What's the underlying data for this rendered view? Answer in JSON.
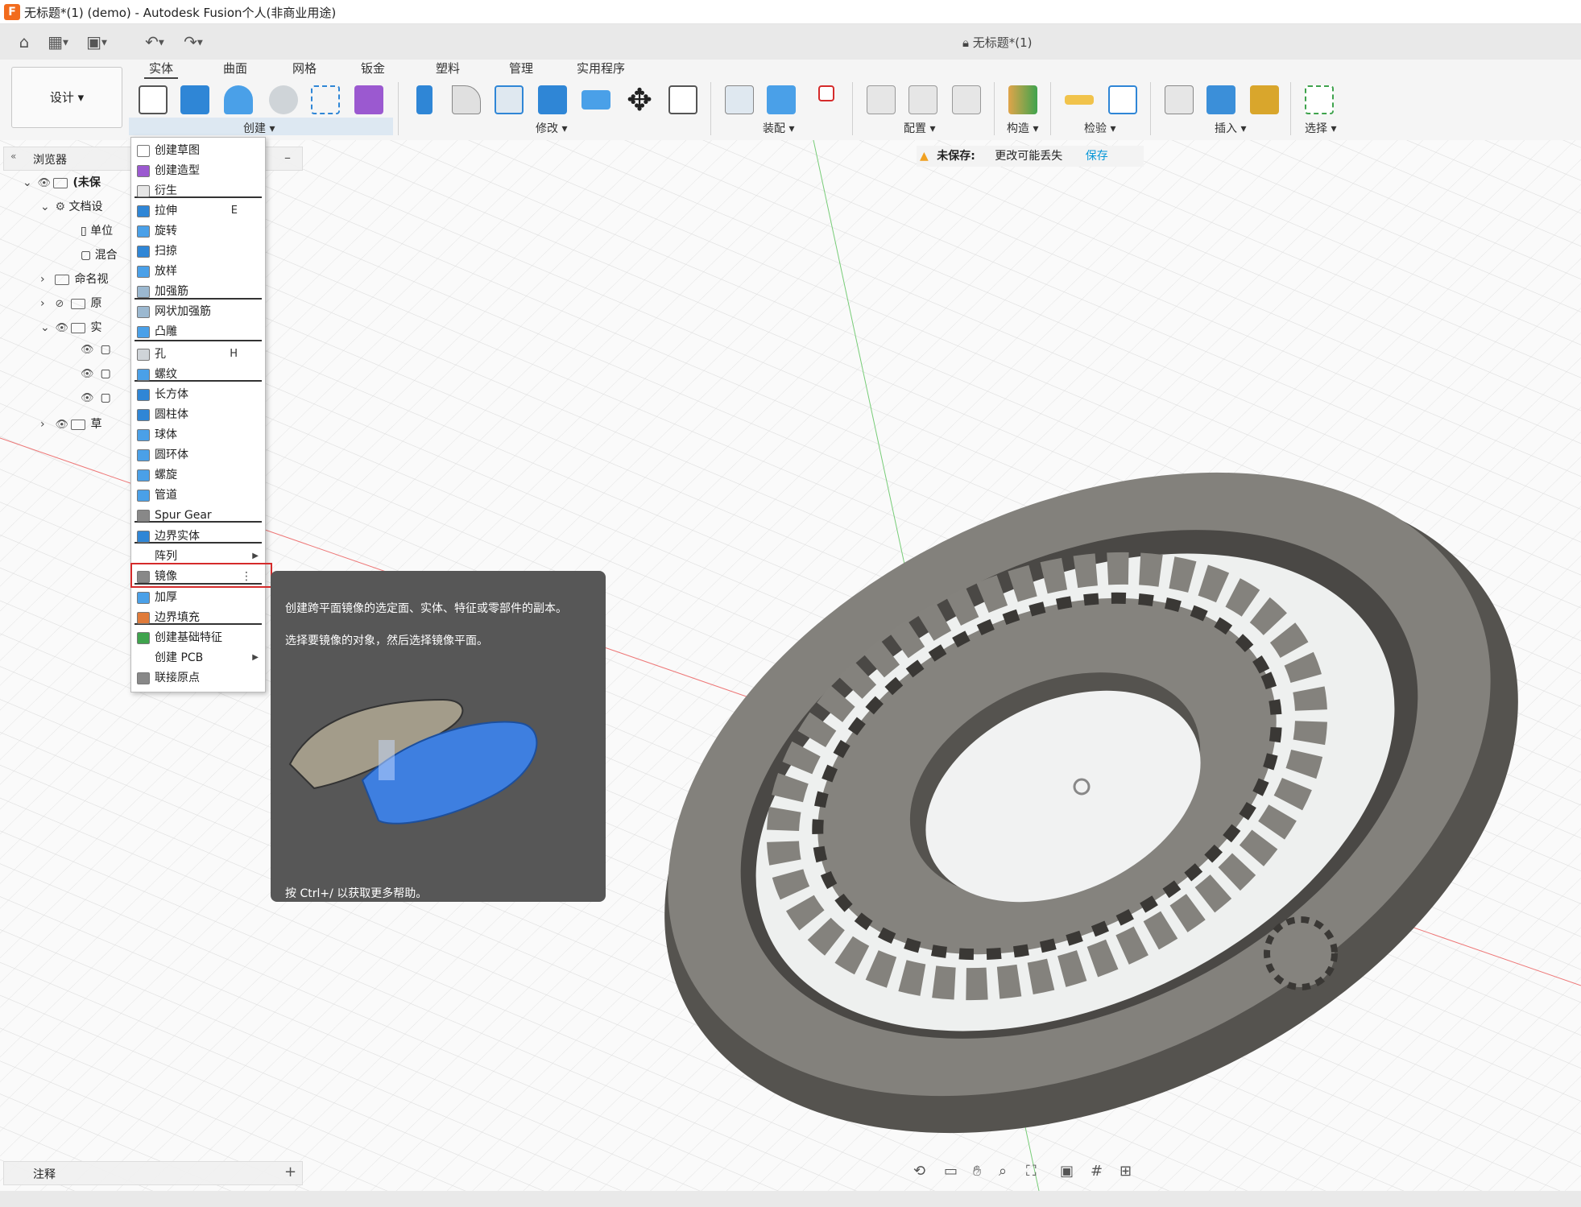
{
  "window": {
    "title": "无标题*(1) (demo) - Autodesk Fusion个人(非商业用途)",
    "document_title": "无标题*(1)"
  },
  "toolbar": {
    "workspace_button": "设计 ▾",
    "tabs": [
      "实体",
      "曲面",
      "网格",
      "钣金",
      "塑料",
      "管理",
      "实用程序"
    ],
    "groups": [
      "创建 ▾",
      "修改 ▾",
      "装配 ▾",
      "配置 ▾",
      "构造 ▾",
      "检验 ▾",
      "插入 ▾",
      "选择 ▾"
    ]
  },
  "unsaved_bar": {
    "label": "未保存:",
    "message": "更改可能丢失",
    "save": "保存"
  },
  "browser": {
    "header": "浏览器",
    "rows": [
      {
        "label": "(未保"
      },
      {
        "label": "文档设"
      },
      {
        "label": "单位"
      },
      {
        "label": "混合"
      },
      {
        "label": "命名视"
      },
      {
        "label": "原"
      },
      {
        "label": "实"
      },
      {
        "label": ""
      },
      {
        "label": ""
      },
      {
        "label": ""
      },
      {
        "label": "草"
      }
    ],
    "footer": "注释"
  },
  "create_menu": {
    "items": [
      {
        "label": "创建草图",
        "icon": "sketch-icon"
      },
      {
        "label": "创建造型",
        "icon": "form-icon"
      },
      {
        "label": "衍生",
        "icon": "derive-icon"
      },
      {
        "label": "拉伸",
        "icon": "extrude-icon",
        "shortcut": "E"
      },
      {
        "label": "旋转",
        "icon": "revolve-icon"
      },
      {
        "label": "扫掠",
        "icon": "sweep-icon"
      },
      {
        "label": "放样",
        "icon": "loft-icon"
      },
      {
        "label": "加强筋",
        "icon": "rib-icon"
      },
      {
        "label": "网状加强筋",
        "icon": "web-icon"
      },
      {
        "label": "凸雕",
        "icon": "emboss-icon"
      },
      {
        "label": "孔",
        "icon": "hole-icon",
        "shortcut": "H"
      },
      {
        "label": "螺纹",
        "icon": "thread-icon"
      },
      {
        "label": "长方体",
        "icon": "box-icon"
      },
      {
        "label": "圆柱体",
        "icon": "cylinder-icon"
      },
      {
        "label": "球体",
        "icon": "sphere-icon"
      },
      {
        "label": "圆环体",
        "icon": "torus-icon"
      },
      {
        "label": "螺旋",
        "icon": "coil-icon"
      },
      {
        "label": "管道",
        "icon": "pipe-icon"
      },
      {
        "label": "Spur Gear",
        "icon": "gear-icon"
      },
      {
        "label": "边界实体",
        "icon": "boundary-icon"
      },
      {
        "label": "阵列",
        "icon": "",
        "submenu": "▶"
      },
      {
        "label": "镜像",
        "icon": "mirror-icon",
        "more": "⋮"
      },
      {
        "label": "加厚",
        "icon": "thicken-icon"
      },
      {
        "label": "边界填充",
        "icon": "boundary-fill-icon"
      },
      {
        "label": "创建基础特征",
        "icon": "base-feature-icon"
      },
      {
        "label": "创建 PCB",
        "icon": "",
        "submenu": "▶"
      },
      {
        "label": "联接原点",
        "icon": "joint-origin-icon"
      }
    ]
  },
  "tooltip": {
    "line1": "创建跨平面镜像的选定面、实体、特征或零部件的副本。",
    "line2": "选择要镜像的对象，然后选择镜像平面。",
    "help": "按 Ctrl+/ 以获取更多帮助。"
  },
  "colors": {
    "accent": "#0696d7",
    "highlight_border": "#d52b2b",
    "tooltip_bg": "#575757",
    "gear": "#7c7a75"
  }
}
